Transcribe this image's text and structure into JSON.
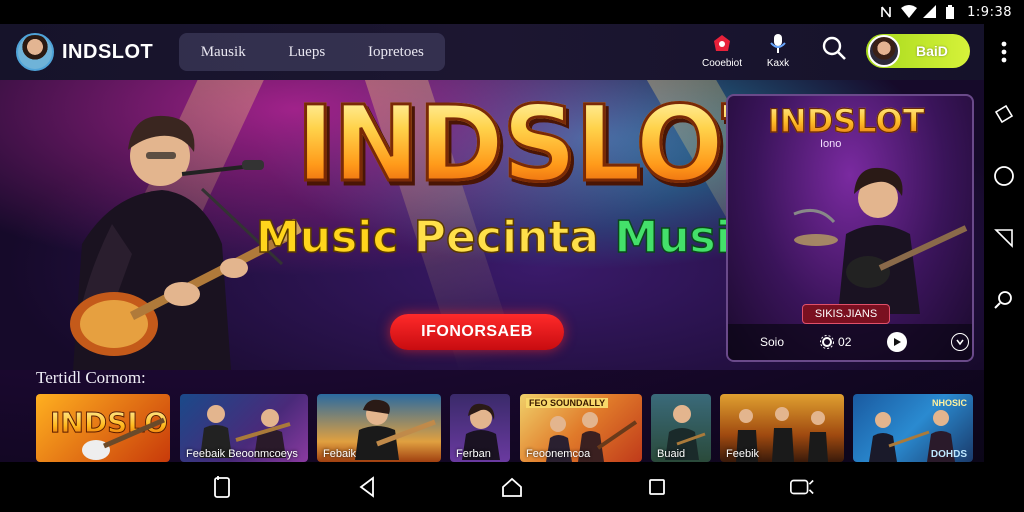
{
  "status_bar": {
    "time": "1:9:38"
  },
  "header": {
    "brand": "INDSLOT",
    "tabs": [
      "Mausik",
      "Lueps",
      "Iopretoes"
    ],
    "actions": [
      {
        "label": "Cooebiot",
        "icon": "notification-bell-icon"
      },
      {
        "label": "Kaxk",
        "icon": "microphone-icon"
      }
    ],
    "user": {
      "name": "BaiD"
    }
  },
  "hero": {
    "title": "INDSLOT",
    "subtitle_words": [
      "Music",
      "Pecinta",
      "Musik"
    ],
    "trademark": "®",
    "cta_label": "IFONORSAEB"
  },
  "feature": {
    "title": "INDSLOT",
    "subtitle": "Iono",
    "badge": "SIKIS.JIANS",
    "time": "Soio",
    "gear_value": "02"
  },
  "section": {
    "label": "Tertidl Cornom:"
  },
  "thumbnails": [
    {
      "label": "",
      "big": "INDSLO"
    },
    {
      "label": "Feebaik  Beoonmcoeys",
      "big": ""
    },
    {
      "label": "Febaik",
      "big": ""
    },
    {
      "label": "Ferban",
      "big": ""
    },
    {
      "label": "Feoonemcoa",
      "big": "",
      "top": "FEO SOUNDALLY"
    },
    {
      "label": "Buaid",
      "big": ""
    },
    {
      "label": "Feebik",
      "big": ""
    },
    {
      "label": "",
      "big": "",
      "topr": "NHOSIC",
      "bottomr": "DOHDS"
    }
  ],
  "colors": {
    "cta": "#e0141a",
    "user_pill": "#b8e02a",
    "hero_gold": "#ffc02a"
  }
}
